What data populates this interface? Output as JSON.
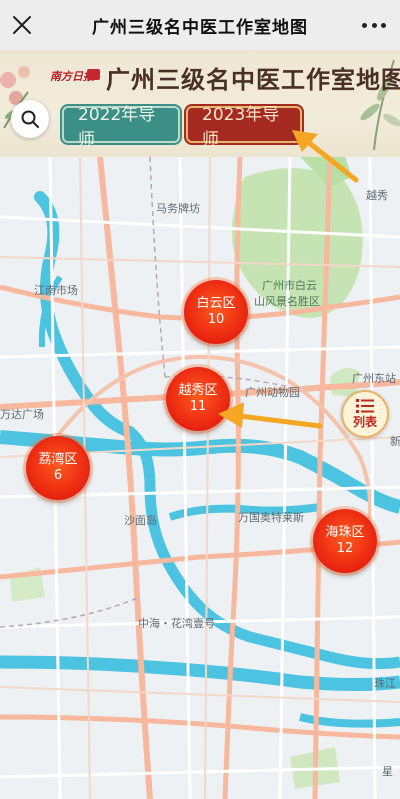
{
  "nav": {
    "title": "广州三级名中医工作室地图",
    "close_icon": "close-icon",
    "more_icon": "more-icon"
  },
  "banner": {
    "brand": "南方日报",
    "title": "广州三级名中医工作室地图",
    "tabs": [
      {
        "label": "2022年导师",
        "color": "#3c8f86"
      },
      {
        "label": "2023年导师",
        "color": "#a52a22",
        "selected": true
      }
    ]
  },
  "search": {
    "icon": "search-icon"
  },
  "list_button": {
    "label": "列表",
    "icon": "list-icon"
  },
  "districts": [
    {
      "name": "白云区",
      "count": "10"
    },
    {
      "name": "越秀区",
      "count": "11"
    },
    {
      "name": "荔湾区",
      "count": "6"
    },
    {
      "name": "海珠区",
      "count": "12"
    }
  ],
  "map_labels": [
    "越秀",
    "马务牌坊",
    "江南市场",
    "广州市白云",
    "山风景名胜区",
    "广州动物园",
    "广州东站",
    "万达广场",
    "沙面岛",
    "万国奥特莱斯",
    "中海・花湾壹号",
    "珠江",
    "星",
    "新"
  ],
  "colors": {
    "accent_red": "#e8220f",
    "teal": "#3c8f86",
    "arrow": "#f5a623",
    "river": "#4cc3e0",
    "park": "#b8dfa4"
  }
}
